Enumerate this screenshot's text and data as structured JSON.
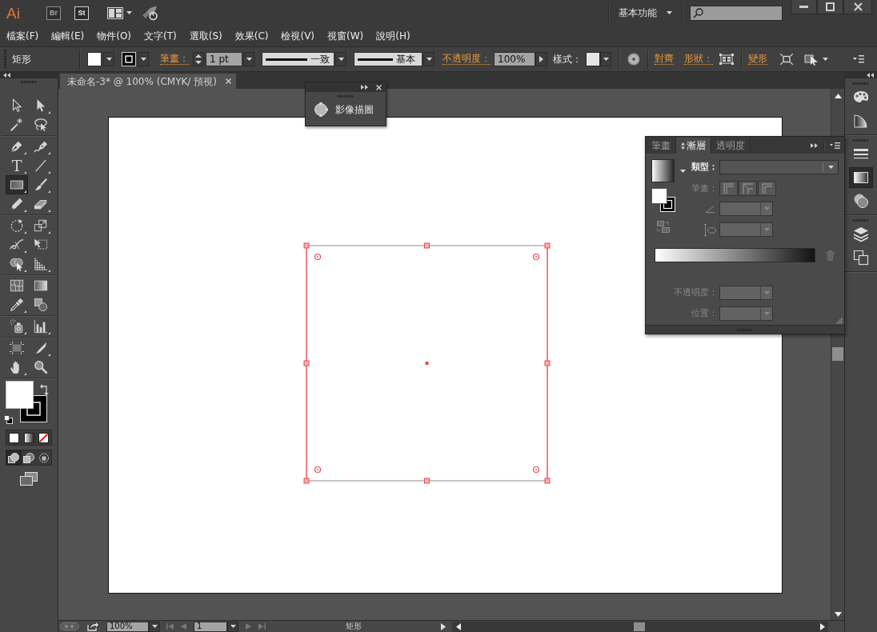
{
  "title_bar": {
    "logo": "Ai",
    "apps": [
      {
        "label": "Br",
        "disabled": true
      },
      {
        "label": "St",
        "disabled": false
      }
    ],
    "workspace": "基本功能"
  },
  "menu_bar": [
    "檔案(F)",
    "編輯(E)",
    "物件(O)",
    "文字(T)",
    "選取(S)",
    "效果(C)",
    "檢視(V)",
    "視窗(W)",
    "說明(H)"
  ],
  "control_bar": {
    "tool_name": "矩形",
    "stroke_link": "筆畫：",
    "stroke_weight": "1 pt",
    "profile": "一致",
    "brush": "基本",
    "opacity_link": "不透明度：",
    "opacity": "100%",
    "style_label": "樣式：",
    "align_link": "對齊",
    "shape_link": "形狀：",
    "transform_link": "變形"
  },
  "document_tab": {
    "title": "未命名-3* @ 100% (CMYK/ 預視)"
  },
  "tools": {
    "groups": [
      [
        {
          "kind": "selection",
          "selected": false,
          "flyout": false
        },
        {
          "kind": "direct_selection",
          "selected": false,
          "flyout": true
        },
        {
          "kind": "magic_wand",
          "selected": false,
          "flyout": false
        },
        {
          "kind": "lasso",
          "selected": false,
          "flyout": false
        }
      ],
      [
        {
          "kind": "pen",
          "selected": false,
          "flyout": true
        },
        {
          "kind": "curve_pen",
          "selected": false,
          "flyout": true
        },
        {
          "kind": "type",
          "glyph": "T",
          "selected": false,
          "flyout": true
        },
        {
          "kind": "line",
          "selected": false,
          "flyout": true
        },
        {
          "kind": "rectangle",
          "selected": true,
          "flyout": true
        },
        {
          "kind": "paintbrush",
          "selected": false,
          "flyout": true
        },
        {
          "kind": "pencil",
          "selected": false,
          "flyout": true
        },
        {
          "kind": "eraser",
          "selected": false,
          "flyout": true
        }
      ],
      [
        {
          "kind": "rotate",
          "selected": false,
          "flyout": true
        },
        {
          "kind": "scale",
          "selected": false,
          "flyout": true
        },
        {
          "kind": "width",
          "selected": false,
          "flyout": true
        },
        {
          "kind": "free_transform",
          "selected": false,
          "flyout": false
        },
        {
          "kind": "shape_builder",
          "selected": false,
          "flyout": true
        },
        {
          "kind": "perspective",
          "selected": false,
          "flyout": true
        }
      ],
      [
        {
          "kind": "mesh",
          "selected": false,
          "flyout": false
        },
        {
          "kind": "gradient",
          "selected": false,
          "flyout": false
        },
        {
          "kind": "eyedropper",
          "selected": false,
          "flyout": true
        },
        {
          "kind": "blend",
          "selected": false,
          "flyout": false
        }
      ],
      [
        {
          "kind": "symbol_sprayer",
          "selected": false,
          "flyout": true
        },
        {
          "kind": "column_graph",
          "selected": false,
          "flyout": true
        }
      ],
      [
        {
          "kind": "artboard",
          "selected": false,
          "flyout": false
        },
        {
          "kind": "slice",
          "selected": false,
          "flyout": true
        },
        {
          "kind": "hand",
          "selected": false,
          "flyout": true
        },
        {
          "kind": "zoom",
          "selected": false,
          "flyout": false
        }
      ]
    ],
    "draw_modes": [
      {
        "kind": "normal",
        "selected": true
      },
      {
        "kind": "behind",
        "selected": false
      },
      {
        "kind": "inside",
        "selected": false
      }
    ]
  },
  "image_trace_panel": {
    "label": "影像描圖"
  },
  "gradient_panel": {
    "tabs": [
      {
        "label": "筆畫",
        "selected": false
      },
      {
        "label": "漸層",
        "selected": true
      },
      {
        "label": "透明度",
        "selected": false
      }
    ],
    "type_field": {
      "label": "類型：",
      "disabled": false
    },
    "stroke_field": {
      "label": "筆畫：",
      "disabled": true
    },
    "angle_field": {
      "disabled": true
    },
    "aspect_field": {
      "disabled": true
    },
    "opacity_field": {
      "label": "不透明度：",
      "disabled": true
    },
    "location_field": {
      "label": "位置：",
      "disabled": true
    }
  },
  "dock": {
    "groups": [
      [
        {
          "kind": "color",
          "selected": false
        },
        {
          "kind": "color_guide",
          "selected": false
        }
      ],
      [
        {
          "kind": "stroke",
          "selected": false
        },
        {
          "kind": "gradient",
          "selected": true
        },
        {
          "kind": "transparency",
          "selected": false
        }
      ],
      [
        {
          "kind": "layers",
          "selected": false
        },
        {
          "kind": "artboards",
          "selected": false
        }
      ]
    ]
  },
  "status_bar": {
    "zoom": "100%",
    "page": "1",
    "tool_name": "矩形"
  }
}
